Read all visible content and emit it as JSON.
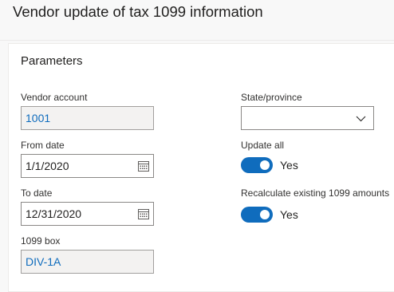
{
  "page": {
    "title": "Vendor update of tax 1099 information"
  },
  "parameters": {
    "heading": "Parameters",
    "vendor_account": {
      "label": "Vendor account",
      "value": "1001"
    },
    "from_date": {
      "label": "From date",
      "value": "1/1/2020"
    },
    "to_date": {
      "label": "To date",
      "value": "12/31/2020"
    },
    "box_1099": {
      "label": "1099 box",
      "value": "DIV-1A"
    },
    "state_province": {
      "label": "State/province",
      "value": ""
    },
    "update_all": {
      "label": "Update all",
      "value": "Yes",
      "on": true
    },
    "recalculate": {
      "label": "Recalculate existing 1099 amounts",
      "value": "Yes",
      "on": true
    }
  },
  "colors": {
    "accent": "#0f6cbd",
    "readonly_bg": "#f3f2f1"
  },
  "icons": [
    "calendar-icon",
    "chevron-down-icon"
  ]
}
